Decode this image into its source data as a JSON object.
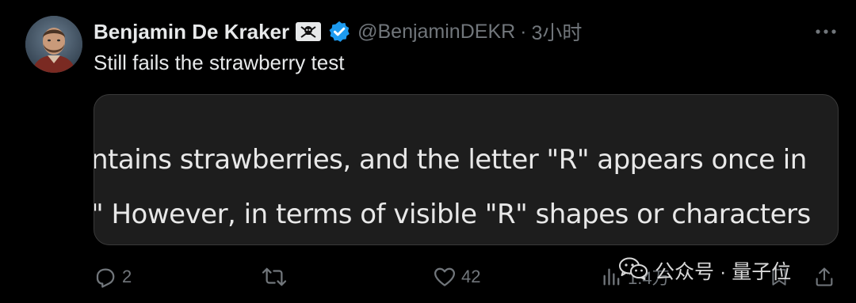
{
  "tweet": {
    "author": {
      "display_name": "Benjamin De Kraker",
      "badge_icon": "skull-crossbones-icon",
      "verified_icon": "verified-badge-icon",
      "handle": "@BenjaminDEKR",
      "separator": "·",
      "time": "3小时"
    },
    "text": "Still fails the strawberry test",
    "media": {
      "lines": [
        "ntains strawberries, and the letter \"R\" appears once in",
        "\" However, in terms of visible \"R\" shapes or characters"
      ]
    },
    "actions": {
      "reply_count": "2",
      "retweet_count": "",
      "like_count": "42",
      "views_count": "1.4万"
    }
  },
  "watermark": {
    "text": "公众号 · 量子位"
  },
  "colors": {
    "background": "#000000",
    "text_primary": "#e7e9ea",
    "text_secondary": "#71767b",
    "verified_blue": "#1d9bf0",
    "media_background": "#1d1d1d"
  }
}
